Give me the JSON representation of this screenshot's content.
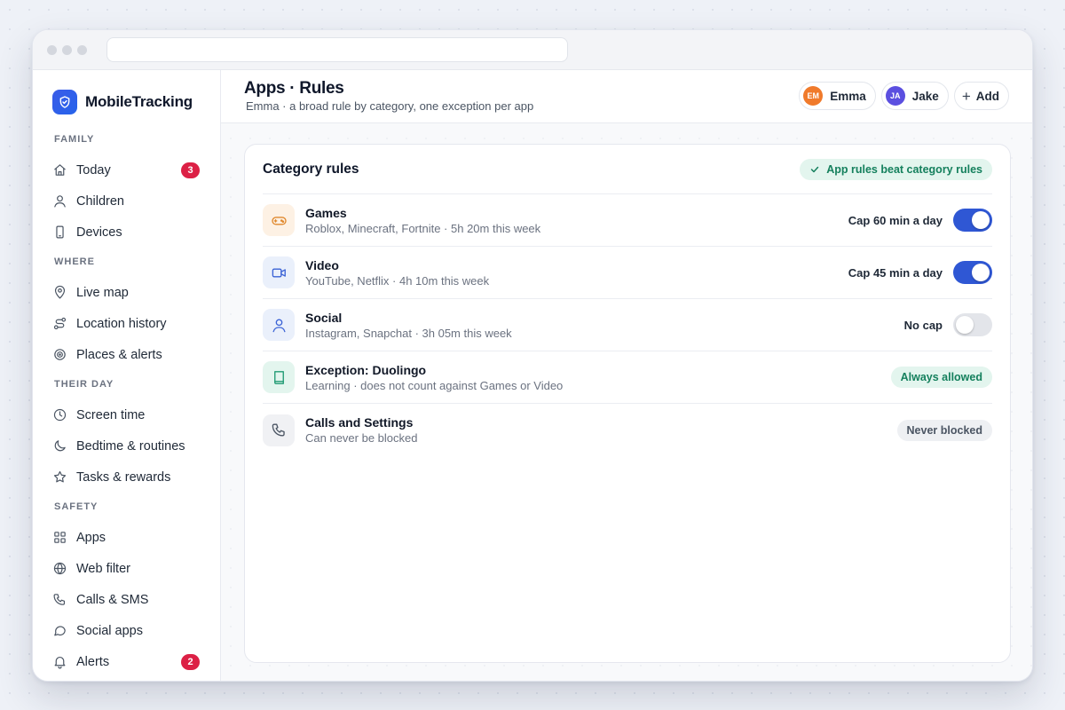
{
  "brand": {
    "name": "MobileTracking"
  },
  "sidebar": {
    "sections": [
      {
        "label": "FAMILY",
        "items": [
          {
            "label": "Today",
            "icon": "home-icon",
            "badge": "3"
          },
          {
            "label": "Children",
            "icon": "user-icon"
          },
          {
            "label": "Devices",
            "icon": "phone-icon"
          }
        ]
      },
      {
        "label": "WHERE",
        "items": [
          {
            "label": "Live map",
            "icon": "map-pin-icon"
          },
          {
            "label": "Location history",
            "icon": "route-icon"
          },
          {
            "label": "Places & alerts",
            "icon": "target-icon"
          }
        ]
      },
      {
        "label": "THEIR DAY",
        "items": [
          {
            "label": "Screen time",
            "icon": "clock-icon"
          },
          {
            "label": "Bedtime & routines",
            "icon": "moon-icon"
          },
          {
            "label": "Tasks & rewards",
            "icon": "star-icon"
          }
        ]
      },
      {
        "label": "SAFETY",
        "items": [
          {
            "label": "Apps",
            "icon": "grid-icon"
          },
          {
            "label": "Web filter",
            "icon": "globe-icon"
          },
          {
            "label": "Calls & SMS",
            "icon": "phone-call-icon"
          },
          {
            "label": "Social apps",
            "icon": "chat-bubble-icon"
          },
          {
            "label": "Alerts",
            "icon": "bell-icon",
            "badge": "2"
          }
        ]
      }
    ]
  },
  "header": {
    "title": "Apps · Rules",
    "subtitle": "Emma · a broad rule by category, one exception per app",
    "children": [
      {
        "initials": "EM",
        "name": "Emma",
        "color": "#f07a2b"
      },
      {
        "initials": "JA",
        "name": "Jake",
        "color": "#5b4fe0"
      }
    ],
    "add_label": "Add"
  },
  "card": {
    "title": "Category rules",
    "badge": "App rules beat category rules",
    "rules": [
      {
        "name": "Games",
        "desc": "Roblox, Minecraft, Fortnite · 5h 20m this week",
        "cap": "Cap 60 min a day",
        "toggle": true,
        "icon": "gamepad-icon",
        "icon_bg": "#fdf1e4",
        "icon_color": "#e0892e"
      },
      {
        "name": "Video",
        "desc": "YouTube, Netflix · 4h 10m this week",
        "cap": "Cap 45 min a day",
        "toggle": true,
        "icon": "video-icon",
        "icon_bg": "#eaf0fb",
        "icon_color": "#3b63d6"
      },
      {
        "name": "Social",
        "desc": "Instagram, Snapchat · 3h 05m this week",
        "cap": "No cap",
        "toggle": false,
        "icon": "user-icon",
        "icon_bg": "#eaf0fb",
        "icon_color": "#3b63d6"
      },
      {
        "name": "Exception: Duolingo",
        "desc": "Learning · does not count against Games or Video",
        "status": "Always allowed",
        "status_tone": "green",
        "icon": "book-icon",
        "icon_bg": "#e3f5ee",
        "icon_color": "#1f9a73"
      },
      {
        "name": "Calls and Settings",
        "desc": "Can never be blocked",
        "status": "Never blocked",
        "status_tone": "gray",
        "icon": "phone-call-icon",
        "icon_bg": "#f0f1f4",
        "icon_color": "#4b5563"
      }
    ]
  }
}
